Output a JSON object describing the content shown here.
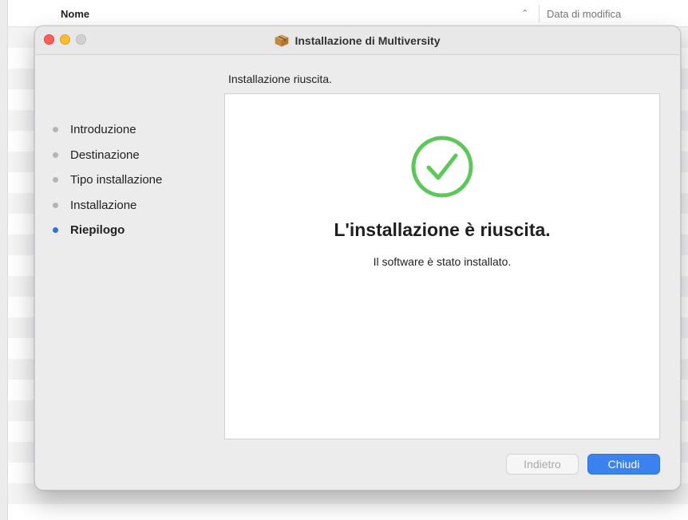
{
  "finder": {
    "column_name": "Nome",
    "column_date": "Data di modifica"
  },
  "window": {
    "title": "Installazione di Multiversity",
    "subtitle": "Installazione riuscita.",
    "title_icon": "package-icon"
  },
  "steps": [
    {
      "label": "Introduzione",
      "active": false
    },
    {
      "label": "Destinazione",
      "active": false
    },
    {
      "label": "Tipo installazione",
      "active": false
    },
    {
      "label": "Installazione",
      "active": false
    },
    {
      "label": "Riepilogo",
      "active": true
    }
  ],
  "content": {
    "icon": "checkmark-circle-icon",
    "icon_color": "#5cc85a",
    "heading": "L'installazione è riuscita.",
    "message": "Il software è stato installato."
  },
  "buttons": {
    "back_label": "Indietro",
    "back_enabled": false,
    "close_label": "Chiudi"
  },
  "colors": {
    "accent": "#3b82f0",
    "close": "#fe5f57",
    "minimize": "#febc2e"
  }
}
